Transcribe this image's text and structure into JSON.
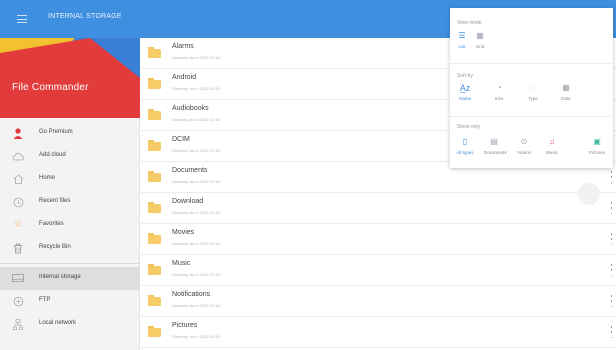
{
  "appbar": {
    "title": "INTERNAL STORAGE",
    "color": "#3f8fe0",
    "menu_icon": "hamburger-menu-icon"
  },
  "sidebar": {
    "banner_title": "File Commander",
    "banner_colors": [
      "#e23b3b",
      "#f3c230",
      "#3a7fd6"
    ],
    "items": [
      {
        "label": "Go Premium",
        "icon": "premium-user-icon",
        "icon_color": "#e03a3a"
      },
      {
        "label": "Add cloud",
        "icon": "cloud-icon"
      },
      {
        "label": "Home",
        "icon": "home-icon"
      },
      {
        "label": "Recent files",
        "icon": "clock-icon"
      },
      {
        "label": "Favorites",
        "icon": "star-icon"
      },
      {
        "label": "Recycle Bin",
        "icon": "trash-icon"
      },
      {
        "label": "Internal storage",
        "icon": "storage-icon",
        "active": true
      },
      {
        "label": "FTP",
        "icon": "ftp-icon"
      },
      {
        "label": "Local network",
        "icon": "network-icon"
      }
    ]
  },
  "files": [
    {
      "name": "Alarms",
      "meta": "Directory  Jun 4 2022 21:16"
    },
    {
      "name": "Android",
      "meta": "Directory  Jun 4 2022 21:16"
    },
    {
      "name": "Audiobooks",
      "meta": "Directory  Jun 4 2022 21:16"
    },
    {
      "name": "DCIM",
      "meta": "Directory  Jun 4 2022 21:16"
    },
    {
      "name": "Documents",
      "meta": "Directory  Jun 4 2022 21:16"
    },
    {
      "name": "Download",
      "meta": "Directory  Jun 4 2022 21:16"
    },
    {
      "name": "Movies",
      "meta": "Directory  Jun 4 2022 21:16"
    },
    {
      "name": "Music",
      "meta": "Directory  Jun 4 2022 21:16"
    },
    {
      "name": "Notifications",
      "meta": "Directory  Jun 4 2022 21:16"
    },
    {
      "name": "Pictures",
      "meta": "Directory  Jun 4 2022 21:16"
    }
  ],
  "view_panel": {
    "view_mode_title": "View mode",
    "view_modes": [
      {
        "label": "List",
        "icon": "list-view-icon",
        "selected": true
      },
      {
        "label": "Grid",
        "icon": "grid-view-icon"
      }
    ],
    "sort_title": "Sort by",
    "sort_options": [
      {
        "label": "Name",
        "icon": "sort-az-icon",
        "selected": true
      },
      {
        "label": "Size",
        "icon": "pie-size-icon"
      },
      {
        "label": "Type",
        "icon": "type-icon"
      },
      {
        "label": "Date",
        "icon": "calendar-icon"
      }
    ],
    "show_title": "Show only",
    "show_options": [
      {
        "label": "All types",
        "icon": "all-files-icon",
        "selected": true
      },
      {
        "label": "Documents",
        "icon": "document-icon"
      },
      {
        "label": "Videos",
        "icon": "video-icon"
      },
      {
        "label": "Music",
        "icon": "music-icon"
      },
      {
        "label": "Pictures",
        "icon": "picture-icon"
      }
    ],
    "accent_color": "#3f8fe0"
  }
}
